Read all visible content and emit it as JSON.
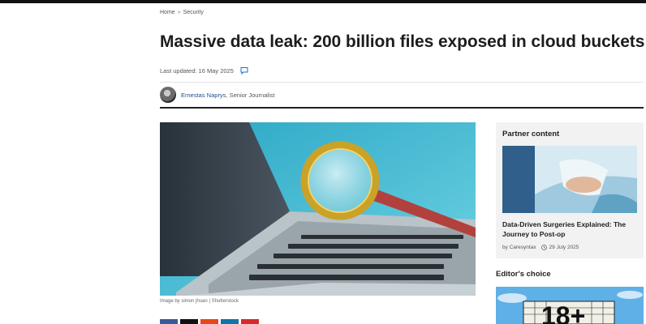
{
  "breadcrumb": {
    "home": "Home",
    "separator": "»",
    "section": "Security"
  },
  "article": {
    "title": "Massive data leak: 200 billion files exposed in cloud buckets",
    "last_updated": "Last updated: 16 May 2025",
    "author_name": "Ernestas Naprys",
    "author_role": ", Senior Journalist",
    "hero_icon": "laptop-magnifying-glass-image",
    "image_caption": "Image by simon jhuan | Shutterstock"
  },
  "share": {
    "buttons": [
      {
        "icon": "facebook-icon",
        "color": "#3b5998"
      },
      {
        "icon": "x-icon",
        "color": "#111111"
      },
      {
        "icon": "reddit-icon",
        "color": "#e8461d"
      },
      {
        "icon": "linkedin-icon",
        "color": "#0e76a8"
      },
      {
        "icon": "email-icon",
        "color": "#d62b2b"
      }
    ]
  },
  "sidebar": {
    "partner_heading": "Partner content",
    "partner_item": {
      "title": "Data-Driven Surgeries Explained: The Journey to Post-op",
      "by": "by Caresyntax",
      "date": "29 July 2025"
    },
    "editors_heading": "Editor's choice",
    "editors_item": {
      "image_text": "18+"
    }
  },
  "colors": {
    "link": "#1e4e8c",
    "topbar": "#111111",
    "sidebar_bg": "#f2f2f2"
  }
}
